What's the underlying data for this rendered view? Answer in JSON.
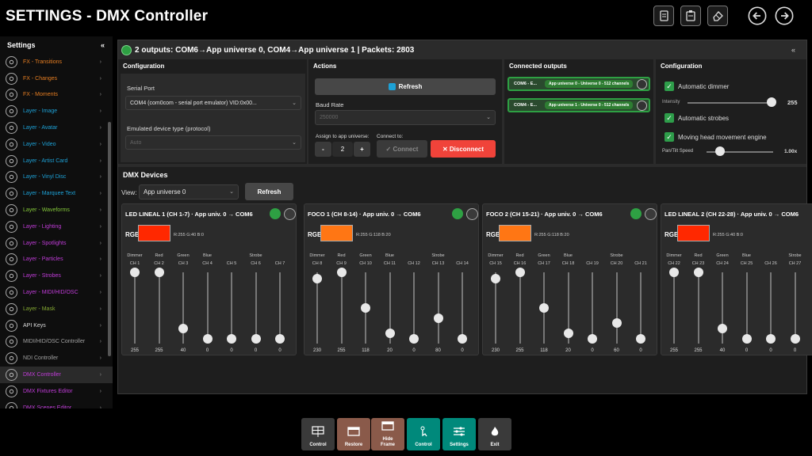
{
  "window": {
    "title": "SETTINGS - DMX Controller"
  },
  "sidebar": {
    "title": "Settings",
    "collapse": "«",
    "items": [
      {
        "label": "FX - Transitions",
        "color": "#e67e22",
        "icon": "transition-icon"
      },
      {
        "label": "FX - Changes",
        "color": "#e67e22",
        "icon": "changes-icon"
      },
      {
        "label": "FX - Moments",
        "color": "#e67e22",
        "icon": "moments-icon"
      },
      {
        "label": "Layer - Image",
        "color": "#1da1d6",
        "icon": "image-icon"
      },
      {
        "label": "Layer - Avatar",
        "color": "#1da1d6",
        "icon": "avatar-icon"
      },
      {
        "label": "Layer - Video",
        "color": "#1da1d6",
        "icon": "video-icon"
      },
      {
        "label": "Layer - Artist Card",
        "color": "#1da1d6",
        "icon": "artist-card-icon"
      },
      {
        "label": "Layer - Vinyl Disc",
        "color": "#1da1d6",
        "icon": "vinyl-icon"
      },
      {
        "label": "Layer - Marquee Text",
        "color": "#1da1d6",
        "icon": "text-icon"
      },
      {
        "label": "Layer - Waveforms",
        "color": "#84c83a",
        "icon": "waveform-icon"
      },
      {
        "label": "Layer - Lighting",
        "color": "#c03cd8",
        "icon": "lighting-icon"
      },
      {
        "label": "Layer - Spotlights",
        "color": "#c03cd8",
        "icon": "spotlight-icon"
      },
      {
        "label": "Layer - Particles",
        "color": "#c03cd8",
        "icon": "particles-icon"
      },
      {
        "label": "Layer - Strobes",
        "color": "#c03cd8",
        "icon": "strobe-icon"
      },
      {
        "label": "Layer - MIDI/HID/OSC",
        "color": "#c03cd8",
        "icon": "midi-icon"
      },
      {
        "label": "Layer - Mask",
        "color": "#84a832",
        "icon": "mask-icon"
      },
      {
        "label": "API Keys",
        "color": "#dddddd",
        "icon": "key-icon"
      },
      {
        "label": "MIDI/HID/OSC Controller",
        "color": "#a0a0a0",
        "icon": "midi-controller-icon"
      },
      {
        "label": "NDI Controller",
        "color": "#a0a0a0",
        "icon": "ndi-icon"
      },
      {
        "label": "DMX Controller",
        "color": "#c03cd8",
        "icon": "dmx-icon"
      },
      {
        "label": "DMX Fixtures Editor",
        "color": "#c03cd8",
        "icon": "dmx-fixtures-icon"
      },
      {
        "label": "DMX Scenes Editor",
        "color": "#c03cd8",
        "icon": "dmx-scenes-icon"
      }
    ]
  },
  "status": {
    "text": "2 outputs: COM6→App universe 0, COM4→App universe 1 | Packets: 2803",
    "collapse": "«"
  },
  "config": {
    "title": "Configuration",
    "serial_port_label": "Serial Port",
    "serial_port_value": "COM4 (com0com - serial port emulator) VID:0x00...",
    "emulated_label": "Emulated device type (protocol)",
    "emulated_value": "Auto"
  },
  "actions": {
    "title": "Actions",
    "refresh": "Refresh",
    "baud_label": "Baud Rate",
    "baud_value": "250000",
    "assign_label": "Assign to app universe:",
    "connect_to_label": "Connect to:",
    "stepper_minus": "-",
    "stepper_value": "2",
    "stepper_plus": "+",
    "connect": "✓ Connect",
    "disconnect": "✕ Disconnect"
  },
  "connected": {
    "title": "Connected outputs",
    "rows": [
      {
        "port": "COM6 - E...",
        "info": "App universe 0 - Universe 0 - 512 channels"
      },
      {
        "port": "COM4 - E...",
        "info": "App universe 1 - Universe 0 - 512 channels"
      }
    ]
  },
  "config2": {
    "title": "Configuration",
    "auto_dimmer": "Automatic dimmer",
    "intensity_label": "Intensity",
    "intensity_value": "255",
    "intensity_fraction": 1.0,
    "auto_strobes": "Automatic strobes",
    "moving_head": "Moving head movement engine",
    "pantilt_label": "Pan/Tilt Speed",
    "pantilt_value": "1.00x",
    "pantilt_fraction": 0.2
  },
  "dmx": {
    "title": "DMX Devices",
    "view_label": "View:",
    "view_value": "App universe 0",
    "refresh": "Refresh",
    "devices": [
      {
        "title": "LED LINEAL 1 (CH 1-7) · App univ. 0 → COM6",
        "rgb_label": "RGB",
        "rgb_color": "#ff2800",
        "rgb_text": "R:255 G:40 B:0",
        "channels": [
          {
            "name": "Dimmer",
            "ch": "CH 1",
            "value": 255
          },
          {
            "name": "Red",
            "ch": "CH 2",
            "value": 255
          },
          {
            "name": "Green",
            "ch": "CH 3",
            "value": 40
          },
          {
            "name": "Blue",
            "ch": "CH 4",
            "value": 0
          },
          {
            "name": "",
            "ch": "CH 5",
            "value": 0
          },
          {
            "name": "Strobe",
            "ch": "CH 6",
            "value": 0
          },
          {
            "name": "",
            "ch": "CH 7",
            "value": 0
          }
        ]
      },
      {
        "title": "FOCO 1 (CH 8-14) · App univ. 0 → COM6",
        "rgb_label": "RGB",
        "rgb_color": "#ff7614",
        "rgb_text": "R:255 G:118 B:20",
        "channels": [
          {
            "name": "Dimmer",
            "ch": "CH 8",
            "value": 230
          },
          {
            "name": "Red",
            "ch": "CH 9",
            "value": 255
          },
          {
            "name": "Green",
            "ch": "CH 10",
            "value": 118
          },
          {
            "name": "Blue",
            "ch": "CH 11",
            "value": 20
          },
          {
            "name": "",
            "ch": "CH 12",
            "value": 0
          },
          {
            "name": "Strobe",
            "ch": "CH 13",
            "value": 80
          },
          {
            "name": "",
            "ch": "CH 14",
            "value": 0
          }
        ]
      },
      {
        "title": "FOCO 2 (CH 15-21) · App univ. 0 → COM6",
        "rgb_label": "RGB",
        "rgb_color": "#ff7614",
        "rgb_text": "R:255 G:118 B:20",
        "channels": [
          {
            "name": "Dimmer",
            "ch": "CH 15",
            "value": 230
          },
          {
            "name": "Red",
            "ch": "CH 16",
            "value": 255
          },
          {
            "name": "Green",
            "ch": "CH 17",
            "value": 118
          },
          {
            "name": "Blue",
            "ch": "CH 18",
            "value": 20
          },
          {
            "name": "",
            "ch": "CH 19",
            "value": 0
          },
          {
            "name": "Strobe",
            "ch": "CH 20",
            "value": 60
          },
          {
            "name": "",
            "ch": "CH 21",
            "value": 0
          }
        ]
      },
      {
        "title": "LED LINEAL 2 (CH 22-28) · App univ. 0 → COM6",
        "rgb_label": "RGB",
        "rgb_color": "#ff2800",
        "rgb_text": "R:255 G:40 B:0",
        "channels": [
          {
            "name": "Dimmer",
            "ch": "CH 22",
            "value": 255
          },
          {
            "name": "Red",
            "ch": "CH 23",
            "value": 255
          },
          {
            "name": "Green",
            "ch": "CH 24",
            "value": 40
          },
          {
            "name": "Blue",
            "ch": "CH 25",
            "value": 0
          },
          {
            "name": "",
            "ch": "CH 26",
            "value": 0
          },
          {
            "name": "Strobe",
            "ch": "CH 27",
            "value": 0
          }
        ]
      }
    ]
  },
  "bottombar": [
    {
      "label": "Control",
      "color": "#3a3a3a",
      "icon": "solar-panel-icon"
    },
    {
      "label": "Restore",
      "color": "#8a5a4a",
      "icon": "window-restore-icon"
    },
    {
      "label": "Hide\nFrame",
      "color": "#8a5a4a",
      "icon": "window-frame-icon"
    },
    {
      "label": "Control",
      "color": "#00897b",
      "icon": "touch-icon"
    },
    {
      "label": "Settings",
      "color": "#00897b",
      "icon": "sliders-icon"
    },
    {
      "label": "Exit",
      "color": "#3a3a3a",
      "icon": "flame-exit-icon"
    }
  ]
}
